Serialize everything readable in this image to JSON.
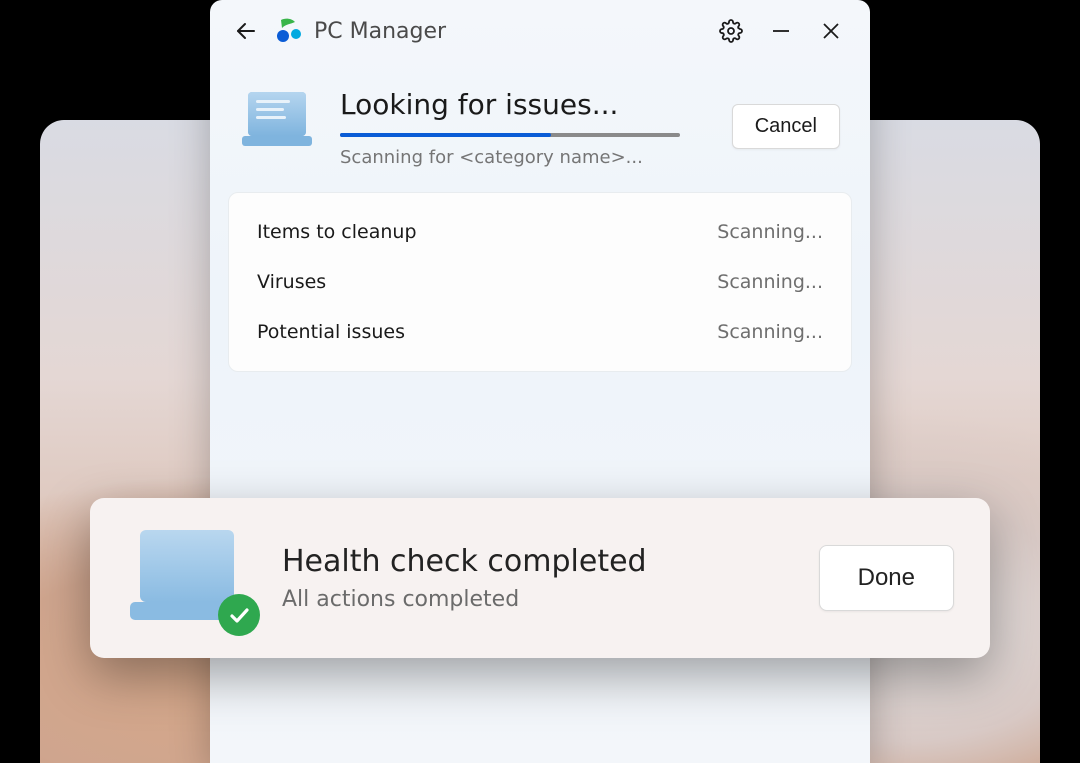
{
  "app": {
    "title": "PC Manager"
  },
  "scan": {
    "title": "Looking for issues...",
    "subtitle": "Scanning for <category name>...",
    "cancel_label": "Cancel",
    "progress_percent": 62
  },
  "results": [
    {
      "label": "Items to cleanup",
      "status": "Scanning..."
    },
    {
      "label": "Viruses",
      "status": "Scanning..."
    },
    {
      "label": "Potential issues",
      "status": "Scanning..."
    }
  ],
  "toast": {
    "title": "Health check completed",
    "subtitle": "All actions completed",
    "done_label": "Done"
  },
  "icons": {
    "back": "back-arrow-icon",
    "logo": "pc-manager-logo-icon",
    "settings": "gear-icon",
    "minimize": "minimize-icon",
    "close": "close-icon",
    "laptop": "laptop-scan-icon",
    "check": "checkmark-icon"
  },
  "colors": {
    "accent": "#0a5cd6",
    "success": "#2fa84f"
  }
}
